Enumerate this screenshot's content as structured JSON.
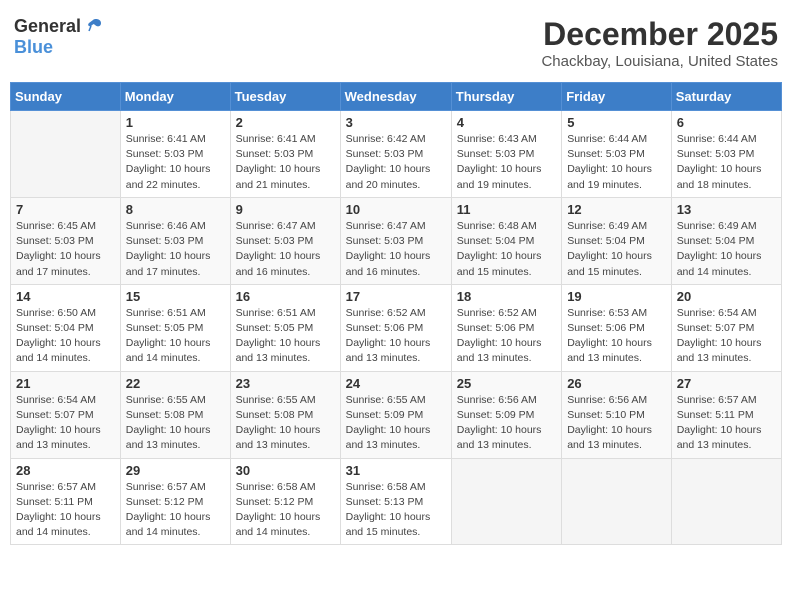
{
  "header": {
    "logo_general": "General",
    "logo_blue": "Blue",
    "month": "December 2025",
    "location": "Chackbay, Louisiana, United States"
  },
  "weekdays": [
    "Sunday",
    "Monday",
    "Tuesday",
    "Wednesday",
    "Thursday",
    "Friday",
    "Saturday"
  ],
  "weeks": [
    [
      {
        "day": "",
        "info": ""
      },
      {
        "day": "1",
        "info": "Sunrise: 6:41 AM\nSunset: 5:03 PM\nDaylight: 10 hours\nand 22 minutes."
      },
      {
        "day": "2",
        "info": "Sunrise: 6:41 AM\nSunset: 5:03 PM\nDaylight: 10 hours\nand 21 minutes."
      },
      {
        "day": "3",
        "info": "Sunrise: 6:42 AM\nSunset: 5:03 PM\nDaylight: 10 hours\nand 20 minutes."
      },
      {
        "day": "4",
        "info": "Sunrise: 6:43 AM\nSunset: 5:03 PM\nDaylight: 10 hours\nand 19 minutes."
      },
      {
        "day": "5",
        "info": "Sunrise: 6:44 AM\nSunset: 5:03 PM\nDaylight: 10 hours\nand 19 minutes."
      },
      {
        "day": "6",
        "info": "Sunrise: 6:44 AM\nSunset: 5:03 PM\nDaylight: 10 hours\nand 18 minutes."
      }
    ],
    [
      {
        "day": "7",
        "info": "Sunrise: 6:45 AM\nSunset: 5:03 PM\nDaylight: 10 hours\nand 17 minutes."
      },
      {
        "day": "8",
        "info": "Sunrise: 6:46 AM\nSunset: 5:03 PM\nDaylight: 10 hours\nand 17 minutes."
      },
      {
        "day": "9",
        "info": "Sunrise: 6:47 AM\nSunset: 5:03 PM\nDaylight: 10 hours\nand 16 minutes."
      },
      {
        "day": "10",
        "info": "Sunrise: 6:47 AM\nSunset: 5:03 PM\nDaylight: 10 hours\nand 16 minutes."
      },
      {
        "day": "11",
        "info": "Sunrise: 6:48 AM\nSunset: 5:04 PM\nDaylight: 10 hours\nand 15 minutes."
      },
      {
        "day": "12",
        "info": "Sunrise: 6:49 AM\nSunset: 5:04 PM\nDaylight: 10 hours\nand 15 minutes."
      },
      {
        "day": "13",
        "info": "Sunrise: 6:49 AM\nSunset: 5:04 PM\nDaylight: 10 hours\nand 14 minutes."
      }
    ],
    [
      {
        "day": "14",
        "info": "Sunrise: 6:50 AM\nSunset: 5:04 PM\nDaylight: 10 hours\nand 14 minutes."
      },
      {
        "day": "15",
        "info": "Sunrise: 6:51 AM\nSunset: 5:05 PM\nDaylight: 10 hours\nand 14 minutes."
      },
      {
        "day": "16",
        "info": "Sunrise: 6:51 AM\nSunset: 5:05 PM\nDaylight: 10 hours\nand 13 minutes."
      },
      {
        "day": "17",
        "info": "Sunrise: 6:52 AM\nSunset: 5:06 PM\nDaylight: 10 hours\nand 13 minutes."
      },
      {
        "day": "18",
        "info": "Sunrise: 6:52 AM\nSunset: 5:06 PM\nDaylight: 10 hours\nand 13 minutes."
      },
      {
        "day": "19",
        "info": "Sunrise: 6:53 AM\nSunset: 5:06 PM\nDaylight: 10 hours\nand 13 minutes."
      },
      {
        "day": "20",
        "info": "Sunrise: 6:54 AM\nSunset: 5:07 PM\nDaylight: 10 hours\nand 13 minutes."
      }
    ],
    [
      {
        "day": "21",
        "info": "Sunrise: 6:54 AM\nSunset: 5:07 PM\nDaylight: 10 hours\nand 13 minutes."
      },
      {
        "day": "22",
        "info": "Sunrise: 6:55 AM\nSunset: 5:08 PM\nDaylight: 10 hours\nand 13 minutes."
      },
      {
        "day": "23",
        "info": "Sunrise: 6:55 AM\nSunset: 5:08 PM\nDaylight: 10 hours\nand 13 minutes."
      },
      {
        "day": "24",
        "info": "Sunrise: 6:55 AM\nSunset: 5:09 PM\nDaylight: 10 hours\nand 13 minutes."
      },
      {
        "day": "25",
        "info": "Sunrise: 6:56 AM\nSunset: 5:09 PM\nDaylight: 10 hours\nand 13 minutes."
      },
      {
        "day": "26",
        "info": "Sunrise: 6:56 AM\nSunset: 5:10 PM\nDaylight: 10 hours\nand 13 minutes."
      },
      {
        "day": "27",
        "info": "Sunrise: 6:57 AM\nSunset: 5:11 PM\nDaylight: 10 hours\nand 13 minutes."
      }
    ],
    [
      {
        "day": "28",
        "info": "Sunrise: 6:57 AM\nSunset: 5:11 PM\nDaylight: 10 hours\nand 14 minutes."
      },
      {
        "day": "29",
        "info": "Sunrise: 6:57 AM\nSunset: 5:12 PM\nDaylight: 10 hours\nand 14 minutes."
      },
      {
        "day": "30",
        "info": "Sunrise: 6:58 AM\nSunset: 5:12 PM\nDaylight: 10 hours\nand 14 minutes."
      },
      {
        "day": "31",
        "info": "Sunrise: 6:58 AM\nSunset: 5:13 PM\nDaylight: 10 hours\nand 15 minutes."
      },
      {
        "day": "",
        "info": ""
      },
      {
        "day": "",
        "info": ""
      },
      {
        "day": "",
        "info": ""
      }
    ]
  ]
}
